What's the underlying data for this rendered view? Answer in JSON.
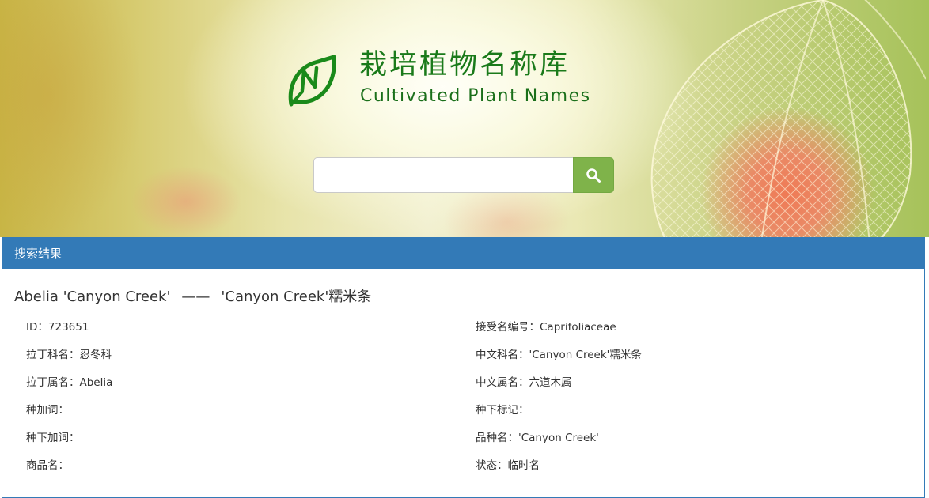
{
  "header": {
    "title_cn": "栽培植物名称库",
    "title_en": "Cultivated Plant Names",
    "logo_icon": "leaf-n-logo",
    "brand_color": "#1a7a1a"
  },
  "search": {
    "value": "",
    "placeholder": "",
    "button_icon": "search-icon",
    "button_color": "#7fb34a"
  },
  "results": {
    "heading": "搜索结果",
    "heading_color": "#337ab7",
    "item": {
      "latin_name": "Abelia 'Canyon Creek'",
      "separator": "——",
      "chinese_name": "'Canyon Creek'糯米条",
      "fields_left": [
        {
          "label": "ID：",
          "value": "723651"
        },
        {
          "label": "拉丁科名：",
          "value": "忍冬科"
        },
        {
          "label": "拉丁属名：",
          "value": "Abelia"
        },
        {
          "label": "种加词：",
          "value": ""
        },
        {
          "label": "种下加词：",
          "value": ""
        },
        {
          "label": "商品名：",
          "value": ""
        }
      ],
      "fields_right": [
        {
          "label": "接受名编号：",
          "value": "Caprifoliaceae"
        },
        {
          "label": "中文科名：",
          "value": "'Canyon Creek'糯米条"
        },
        {
          "label": "中文属名：",
          "value": "六道木属"
        },
        {
          "label": "种下标记：",
          "value": ""
        },
        {
          "label": "品种名：",
          "value": "'Canyon Creek'"
        },
        {
          "label": "状态：",
          "value": "临时名"
        }
      ]
    }
  }
}
